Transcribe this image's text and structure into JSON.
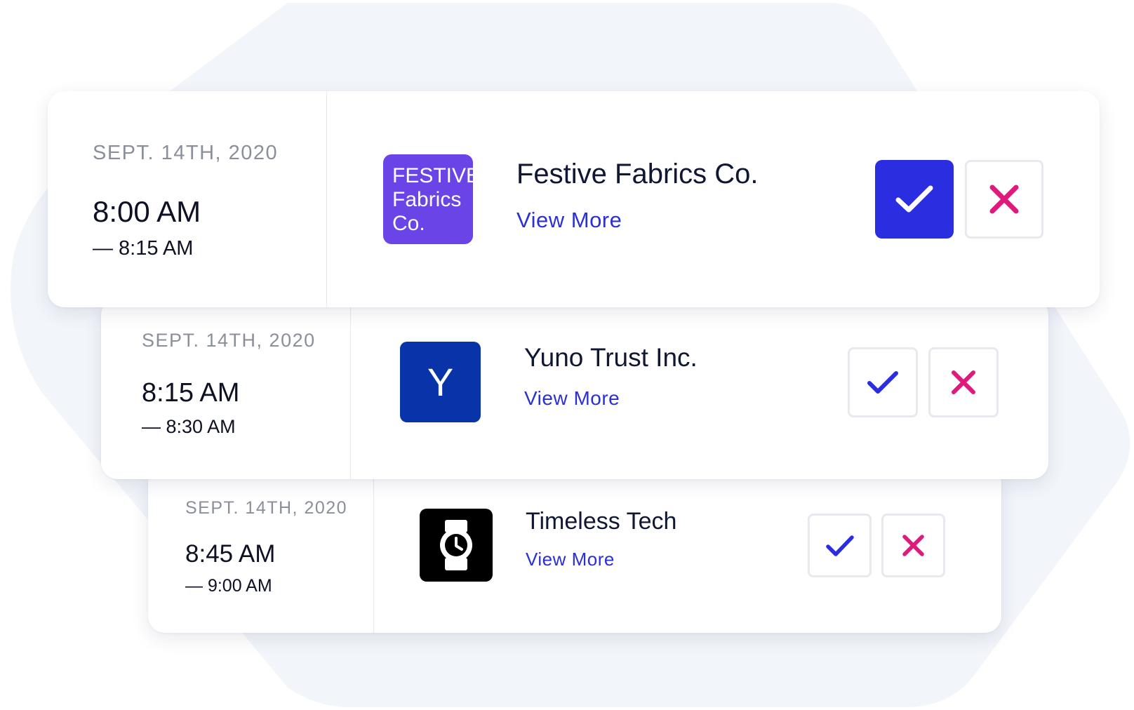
{
  "colors": {
    "background_blob": "#f2f5fa",
    "accent_blue": "#2b2ee0",
    "reject_pink": "#e01a7c",
    "festive_logo": "#6a44e6",
    "yuno_logo": "#0933a8",
    "timeless_logo": "#000000"
  },
  "appointments": [
    {
      "date": "SEPT. 14TH, 2020",
      "start": "8:00 AM",
      "end": "— 8:15 AM",
      "company": "Festive Fabrics Co.",
      "logo_text": [
        "FESTIVE",
        "Fabrics",
        "Co."
      ],
      "view_more": "View More",
      "accept_icon": "check-icon",
      "reject_icon": "close-icon",
      "accepted": true
    },
    {
      "date": "SEPT. 14TH, 2020",
      "start": "8:15 AM",
      "end": "— 8:30 AM",
      "company": "Yuno Trust Inc.",
      "logo_letter": "Y",
      "view_more": "View More",
      "accept_icon": "check-icon",
      "reject_icon": "close-icon",
      "accepted": false
    },
    {
      "date": "SEPT. 14TH, 2020",
      "start": "8:45 AM",
      "end": "— 9:00 AM",
      "company": "Timeless Tech",
      "logo_icon": "watch-icon",
      "view_more": "View More",
      "accept_icon": "check-icon",
      "reject_icon": "close-icon",
      "accepted": false
    }
  ]
}
